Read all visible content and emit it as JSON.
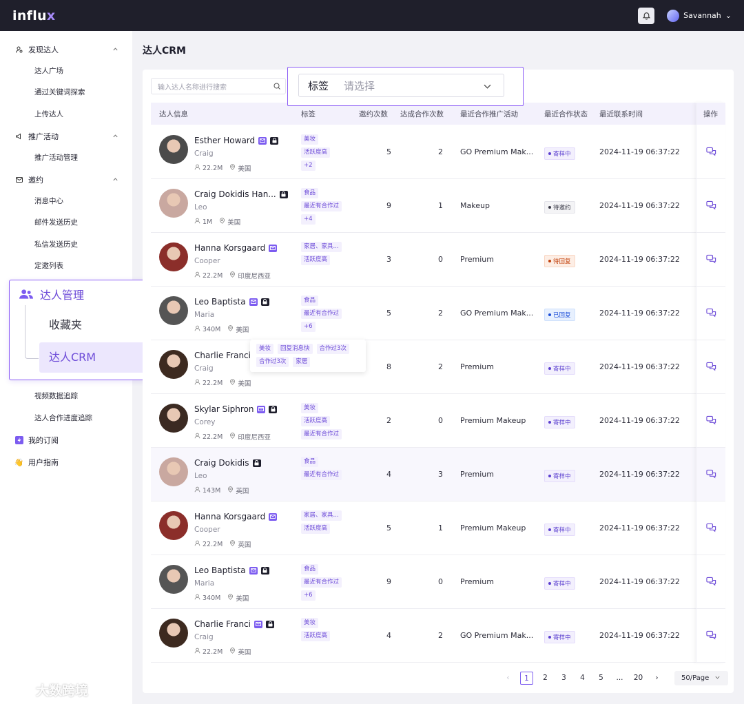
{
  "app": {
    "logo_prefix": "influ",
    "logo_x": "x",
    "user_name": "Savannah"
  },
  "sidebar": {
    "groups": [
      {
        "label": "发现达人",
        "items": [
          "达人广场",
          "通过关键词探索",
          "上传达人"
        ]
      },
      {
        "label": "推广活动",
        "items": [
          "推广活动管理"
        ]
      },
      {
        "label": "邀约",
        "items": [
          "消息中心",
          "邮件发送历史",
          "私信发送历史",
          "定邀列表"
        ]
      }
    ],
    "manage": {
      "label": "达人管理",
      "items": [
        "收藏夹",
        "达人CRM"
      ]
    },
    "tracking_items": [
      "视频数据追踪",
      "达人合作进度追踪"
    ],
    "subscription": "我的订阅",
    "guide": "用户指南"
  },
  "page": {
    "title": "达人CRM"
  },
  "search": {
    "placeholder": "输入达人名称进行搜索"
  },
  "filter": {
    "label": "标签",
    "placeholder": "请选择"
  },
  "table": {
    "headers": [
      "达人信息",
      "标签",
      "邀约次数",
      "达成合作次数",
      "最近合作推广活动",
      "最近合作状态",
      "最近联系时间",
      "操作"
    ],
    "rows": [
      {
        "name": "Esther Howard",
        "sub": "Craig",
        "followers": "22.2M",
        "country": "美国",
        "tags": [
          "美妆",
          "活跃度高",
          "+2"
        ],
        "invites": "5",
        "deals": "2",
        "campaign": "GO Premium Mak...",
        "status": "寄样中",
        "status_kind": "send",
        "time": "2024-11-19 06:37:22",
        "mail": true,
        "lock": true,
        "avatar_color": "#4b4b4b"
      },
      {
        "name": "Craig Dokidis Han...",
        "sub": "Leo",
        "followers": "1M",
        "country": "美国",
        "tags": [
          "食品",
          "最近有合作过",
          "+4"
        ],
        "invites": "9",
        "deals": "1",
        "campaign": "Makeup",
        "status": "待邀约",
        "status_kind": "wait",
        "time": "2024-11-19 06:37:22",
        "mail": false,
        "lock": true,
        "avatar_color": "#c9a8a0"
      },
      {
        "name": "Hanna Korsgaard",
        "sub": "Cooper",
        "followers": "22.2M",
        "country": "印度尼西亚",
        "tags": [
          "家居、家具...",
          "活跃度高"
        ],
        "invites": "3",
        "deals": "0",
        "campaign": "Premium",
        "status": "待回复",
        "status_kind": "reply",
        "time": "2024-11-19 06:37:22",
        "mail": true,
        "lock": false,
        "avatar_color": "#8b2e2a"
      },
      {
        "name": "Leo Baptista",
        "sub": "Maria",
        "followers": "340M",
        "country": "美国",
        "tags": [
          "食品",
          "最近有合作过",
          "+6"
        ],
        "invites": "5",
        "deals": "2",
        "campaign": "GO Premium Mak...",
        "status": "已回复",
        "status_kind": "done",
        "time": "2024-11-19 06:37:22",
        "mail": true,
        "lock": true,
        "avatar_color": "#555555"
      },
      {
        "name": "Charlie Franci",
        "sub": "Craig",
        "followers": "22.2M",
        "country": "美国",
        "tags": [],
        "invites": "8",
        "deals": "2",
        "campaign": "Premium",
        "status": "寄样中",
        "status_kind": "send",
        "time": "2024-11-19 06:37:22",
        "mail": false,
        "lock": false,
        "avatar_color": "#3d2a20"
      },
      {
        "name": "Skylar Siphron",
        "sub": "Corey",
        "followers": "22.2M",
        "country": "印度尼西亚",
        "tags": [
          "美妆",
          "活跃度高",
          "最近有合作过"
        ],
        "invites": "2",
        "deals": "0",
        "campaign": "Premium Makeup",
        "status": "寄样中",
        "status_kind": "send",
        "time": "2024-11-19 06:37:22",
        "mail": true,
        "lock": true,
        "avatar_color": "#3b2a22"
      },
      {
        "name": "Craig Dokidis",
        "sub": "Leo",
        "followers": "143M",
        "country": "英国",
        "tags": [
          "食品",
          "最近有合作过"
        ],
        "invites": "4",
        "deals": "3",
        "campaign": "Premium",
        "status": "寄样中",
        "status_kind": "send",
        "time": "2024-11-19 06:37:22",
        "mail": false,
        "lock": true,
        "avatar_color": "#c9a8a0"
      },
      {
        "name": "Hanna Korsgaard",
        "sub": "Cooper",
        "followers": "22.2M",
        "country": "英国",
        "tags": [
          "家居、家具...",
          "活跃度高"
        ],
        "invites": "5",
        "deals": "1",
        "campaign": "Premium Makeup",
        "status": "寄样中",
        "status_kind": "send",
        "time": "2024-11-19 06:37:22",
        "mail": true,
        "lock": false,
        "avatar_color": "#8b2e2a"
      },
      {
        "name": "Leo Baptista",
        "sub": "Maria",
        "followers": "340M",
        "country": "美国",
        "tags": [
          "食品",
          "最近有合作过",
          "+6"
        ],
        "invites": "9",
        "deals": "0",
        "campaign": "Premium",
        "status": "寄样中",
        "status_kind": "send",
        "time": "2024-11-19 06:37:22",
        "mail": true,
        "lock": true,
        "avatar_color": "#555555"
      },
      {
        "name": "Charlie Franci",
        "sub": "Craig",
        "followers": "22.2M",
        "country": "英国",
        "tags": [
          "美妆",
          "活跃度高"
        ],
        "invites": "4",
        "deals": "2",
        "campaign": "GO Premium Mak...",
        "status": "寄样中",
        "status_kind": "send",
        "time": "2024-11-19 06:37:22",
        "mail": true,
        "lock": true,
        "avatar_color": "#3d2a20"
      }
    ]
  },
  "tag_popover": {
    "tags": [
      "美妆",
      "回复消息快",
      "合作过3次",
      "合作过3次",
      "家居"
    ]
  },
  "pagination": {
    "prev": "‹",
    "next": "›",
    "pages": [
      "1",
      "2",
      "3",
      "4",
      "5",
      "...",
      "20"
    ],
    "active": "1",
    "page_size": "50/Page"
  },
  "watermark": "大数跨境"
}
